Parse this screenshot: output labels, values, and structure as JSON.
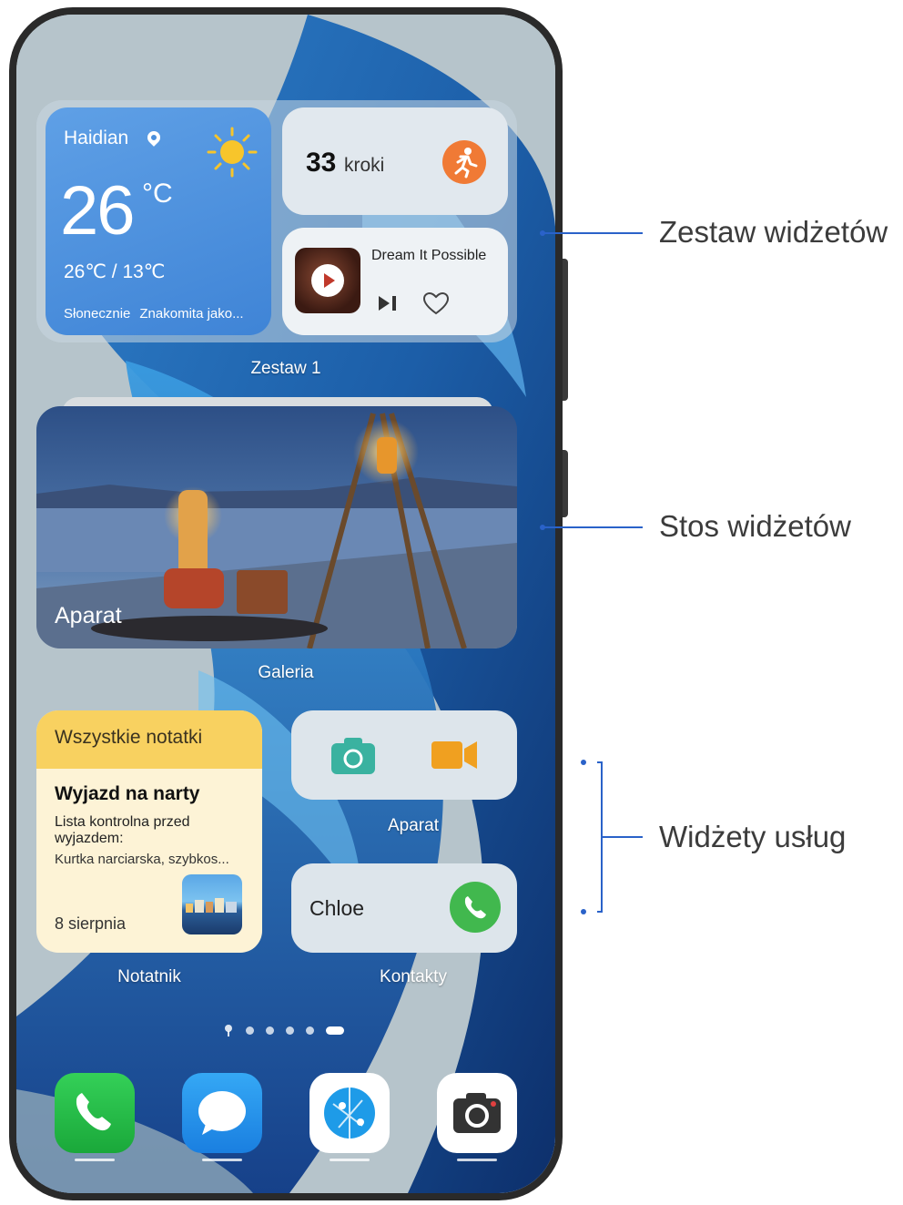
{
  "widget_set": {
    "weather": {
      "city": "Haidian",
      "temperature": "26",
      "unit": "°C",
      "range": "26℃ / 13℃",
      "condition": "Słonecznie",
      "air_quality": "Znakomita jako..."
    },
    "steps": {
      "count": "33",
      "unit": "kroki"
    },
    "music": {
      "track": "Dream It Possible"
    },
    "label": "Zestaw 1"
  },
  "widget_stack": {
    "card_label": "Aparat",
    "label": "Galeria"
  },
  "notes_widget": {
    "header": "Wszystkie notatki",
    "title": "Wyjazd na narty",
    "body": "Lista kontrolna przed wyjazdem:",
    "item": "Kurtka narciarska, szybkos...",
    "date": "8 sierpnia",
    "label": "Notatnik"
  },
  "camera_widget": {
    "label": "Aparat"
  },
  "contact_widget": {
    "name": "Chloe",
    "label": "Kontakty"
  },
  "page_indicator": {
    "count": 5,
    "active_index": 4
  },
  "dock": {
    "apps": [
      "phone-app-icon",
      "messages-app-icon",
      "browser-app-icon",
      "camera-app-icon"
    ]
  },
  "annotations": {
    "widget_set": "Zestaw widżetów",
    "widget_stack": "Stos widżetów",
    "service_widgets": "Widżety usług"
  },
  "colors": {
    "annotation_blue": "#2a62c9",
    "steps_orange": "#f07a35",
    "call_green": "#41b84e",
    "notes_yellow": "#f8d160",
    "camera_teal": "#3ab2a0",
    "video_orange": "#f0a020"
  }
}
